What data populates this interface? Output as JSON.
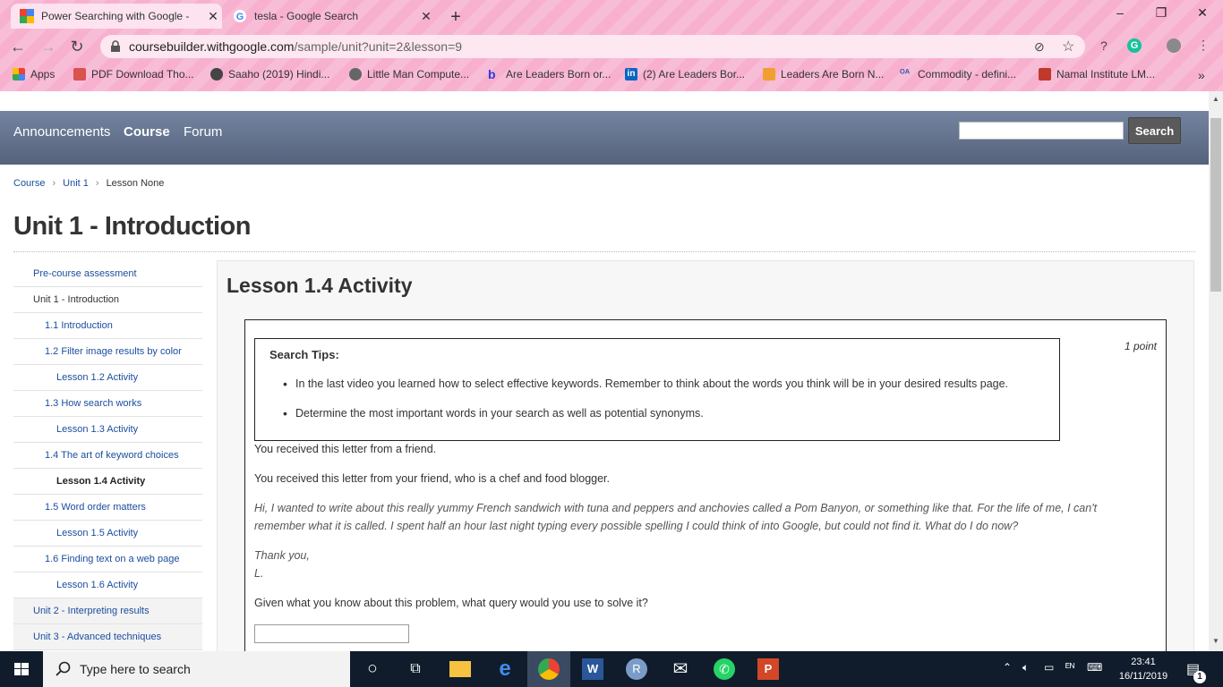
{
  "browser": {
    "tabs": [
      {
        "title": "Power Searching with Google - ",
        "active": true
      },
      {
        "title": "tesla - Google Search",
        "active": false
      }
    ],
    "new_tab": "+",
    "window_controls": {
      "minimize": "–",
      "maximize": "❐",
      "close": "✕"
    },
    "url_host": "coursebuilder.withgoogle.com",
    "url_path": "/sample/unit?unit=2&lesson=9",
    "bookmarks": [
      {
        "label": "Apps",
        "color": "#e54d42"
      },
      {
        "label": "PDF Download Tho...",
        "color": "#d9534f"
      },
      {
        "label": "Saaho (2019) Hindi...",
        "color": "#444444"
      },
      {
        "label": "Little Man Compute...",
        "color": "#555555"
      },
      {
        "label": "Are Leaders Born or...",
        "color": "#2b3bd8"
      },
      {
        "label": "(2) Are Leaders Bor...",
        "color": "#0a66c2"
      },
      {
        "label": "Leaders Are Born N...",
        "color": "#f0a030"
      },
      {
        "label": "Commodity - defini...",
        "color": "#3355aa"
      },
      {
        "label": "Namal Institute LM...",
        "color": "#c0392b"
      }
    ],
    "more_bookmarks": "»"
  },
  "site": {
    "nav": {
      "announcements": "Announcements",
      "course": "Course",
      "forum": "Forum"
    },
    "search_button": "Search"
  },
  "breadcrumb": {
    "course": "Course",
    "unit": "Unit 1",
    "lesson": "Lesson None",
    "sep": "›"
  },
  "unit_title": "Unit 1 - Introduction",
  "sidebar": [
    {
      "label": "Pre-course assessment",
      "level": 0,
      "link": true
    },
    {
      "label": "Unit 1 - Introduction",
      "level": 0,
      "link": false
    },
    {
      "label": "1.1 Introduction",
      "level": 1,
      "link": true
    },
    {
      "label": "1.2 Filter image results by color",
      "level": 1,
      "link": true
    },
    {
      "label": "Lesson 1.2 Activity",
      "level": 2,
      "link": true
    },
    {
      "label": "1.3 How search works",
      "level": 1,
      "link": true
    },
    {
      "label": "Lesson 1.3 Activity",
      "level": 2,
      "link": true
    },
    {
      "label": "1.4 The art of keyword choices",
      "level": 1,
      "link": true
    },
    {
      "label": "Lesson 1.4 Activity",
      "level": 2,
      "link": false,
      "current": true
    },
    {
      "label": "1.5 Word order matters",
      "level": 1,
      "link": true
    },
    {
      "label": "Lesson 1.5 Activity",
      "level": 2,
      "link": true
    },
    {
      "label": "1.6 Finding text on a web page",
      "level": 1,
      "link": true
    },
    {
      "label": "Lesson 1.6 Activity",
      "level": 2,
      "link": true
    },
    {
      "label": "Unit 2 - Interpreting results",
      "level": 0,
      "link": true,
      "shaded": true
    },
    {
      "label": "Unit 3 - Advanced techniques",
      "level": 0,
      "link": true,
      "shaded": true
    }
  ],
  "lesson": {
    "title": "Lesson 1.4 Activity",
    "points": "1 point",
    "tips_title": "Search Tips:",
    "tips": [
      "In the last video you learned how to select effective keywords. Remember to think about the words you think will be in your desired results page.",
      "Determine the most important words in your search as well as potential synonyms."
    ],
    "para1": "You received this letter from a friend.",
    "para2": "You received this letter from your friend, who is a chef and food blogger.",
    "letter_line1": "Hi, I wanted to write about this really yummy French sandwich with tuna and peppers and anchovies called a Pom Banyon, or something like that. For the life of me, I can't",
    "letter_line2": "remember what it is called. I spent half an hour last night typing every possible spelling I could think of into Google, but could not find it. What do I do now?",
    "signoff": "Thank you,",
    "signature": "L.",
    "question": "Given what you know about this problem, what query would you use to solve it?",
    "answer_value": ""
  },
  "taskbar": {
    "search_placeholder": "Type here to search",
    "time": "23:41",
    "date": "16/11/2019",
    "notification_count": "1"
  }
}
